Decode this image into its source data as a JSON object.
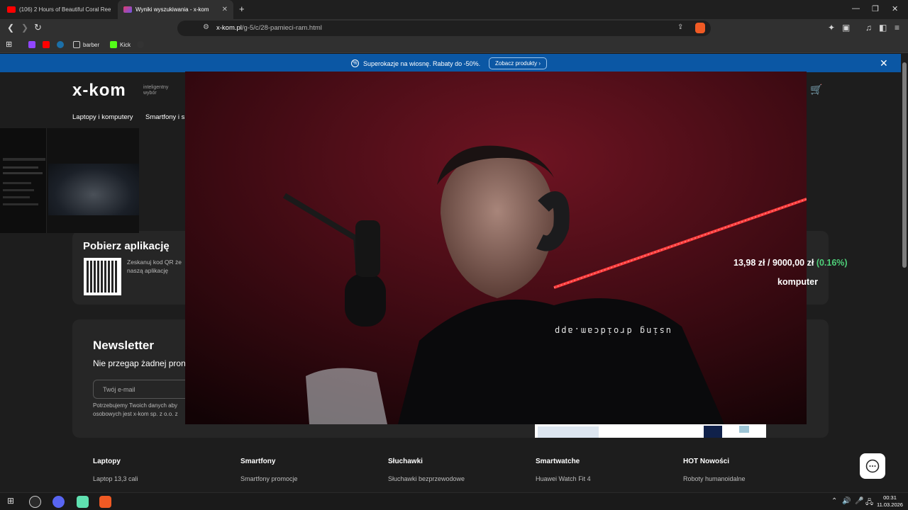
{
  "tabs": [
    {
      "title": "(106) 2 Hours of Beautiful Coral Reef",
      "active": false
    },
    {
      "title": "Wyniki wyszukiwania - x-kom",
      "active": true
    }
  ],
  "new_tab": "+",
  "window_controls": {
    "minimize": "—",
    "restore": "❐",
    "close": "✕"
  },
  "address": {
    "domain": "x-kom.pl",
    "path": "/g-5/c/28-pamieci-ram.html"
  },
  "bookmarks": [
    {
      "label": "",
      "icon": "twitch-icon",
      "color": "#9146ff"
    },
    {
      "label": "",
      "icon": "youtube-icon",
      "color": "#ff0000"
    },
    {
      "label": "",
      "icon": "steam-icon",
      "color": "#1b6fa8"
    },
    {
      "label": "barber",
      "icon": "folder-icon",
      "color": "#cccccc"
    },
    {
      "label": "Kick",
      "icon": "kick-icon",
      "color": "#53fc18"
    },
    {
      "label": "",
      "icon": "tipply-icon",
      "color": "#222222"
    }
  ],
  "promo": {
    "text": "Superokazje na wiosnę. Rabaty do -50%.",
    "button": "Zobacz produkty",
    "bg": "#0b57a4"
  },
  "site": {
    "logo": "x-kom",
    "logo_tagline": "inteligentny wybór",
    "nav": [
      "Laptopy i komputery",
      "Smartfony i s"
    ]
  },
  "app_card": {
    "title": "Pobierz aplikację",
    "text_line1": "Zeskanuj kod QR że",
    "text_line2": "naszą aplikację"
  },
  "newsletter": {
    "title": "Newsletter",
    "subtitle": "Nie przegap żadnej pron",
    "placeholder": "Twój e-mail",
    "legal_line1": "Potrzebujemy Twoich danych aby",
    "legal_line2": "osobowych jest x-kom sp. z o.o. z"
  },
  "footer": [
    {
      "heading": "Laptopy",
      "link": "Laptop 13,3 cali"
    },
    {
      "heading": "Smartfony",
      "link": "Smartfony promocje"
    },
    {
      "heading": "Słuchawki",
      "link": "Słuchawki bezprzewodowe"
    },
    {
      "heading": "Smartwatche",
      "link": "Huawei Watch Fit 4"
    },
    {
      "heading": "HOT Nowości",
      "link": "Roboty humanoidalne"
    }
  ],
  "overlay": {
    "watermark": "using droidcam.app",
    "ticker_amount": "13,98 zł",
    "ticker_sep": "/",
    "ticker_goal": "9000,00 zł",
    "ticker_pct": "(0.16%)",
    "ticker_word": "komputer"
  },
  "taskbar": {
    "clock_time": "00:31",
    "clock_date": "11.03.2026"
  }
}
